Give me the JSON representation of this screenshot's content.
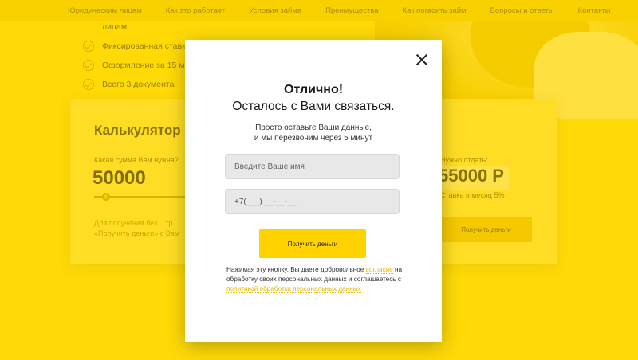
{
  "nav": {
    "items": [
      "Юридическим лицам",
      "Как это работает",
      "Условия займа",
      "Преимущества",
      "Как погасить займ",
      "Вопросы и ответы",
      "Контакты"
    ]
  },
  "features": {
    "items": [
      "лицам",
      "Фиксированная ставка 5% в месяц",
      "Оформление за 15 минут",
      "Всего 3 документа"
    ]
  },
  "calculator": {
    "title": "Калькулятор за",
    "question": "Какая сумма Вам нужна?",
    "amount": "50000",
    "note_line1": "Для получения без... тр",
    "note_line2": "«Получить деньги» с Вам",
    "return_label": "Нужно отдать:",
    "return_amount": "55000 Р",
    "rate": "Ставка в месяц 5%",
    "button": "Получить деньги"
  },
  "modal": {
    "title": "Отлично!",
    "subtitle": "Осталось с Вами связаться.",
    "desc_line1": "Просто оставьте Ваши данные,",
    "desc_line2": "и мы перезвоним через 5 минут",
    "name_placeholder": "Введите Ваше имя",
    "phone_value": "+7(___) __-__-__",
    "submit_label": "Получить деньги",
    "legal_text1": "Нажимая эту кнопку, Вы даете добровольное ",
    "legal_link1": "согласие",
    "legal_text2": " на обработку своих персональных данных и соглашаетесь с ",
    "legal_link2": "политикой обработки персональных данных"
  },
  "colors": {
    "accent": "#ffd200",
    "background": "#ffdb0a",
    "link": "#e6b800"
  },
  "icons": {
    "close": "close-icon",
    "feature_check": "check-circle-icon"
  }
}
